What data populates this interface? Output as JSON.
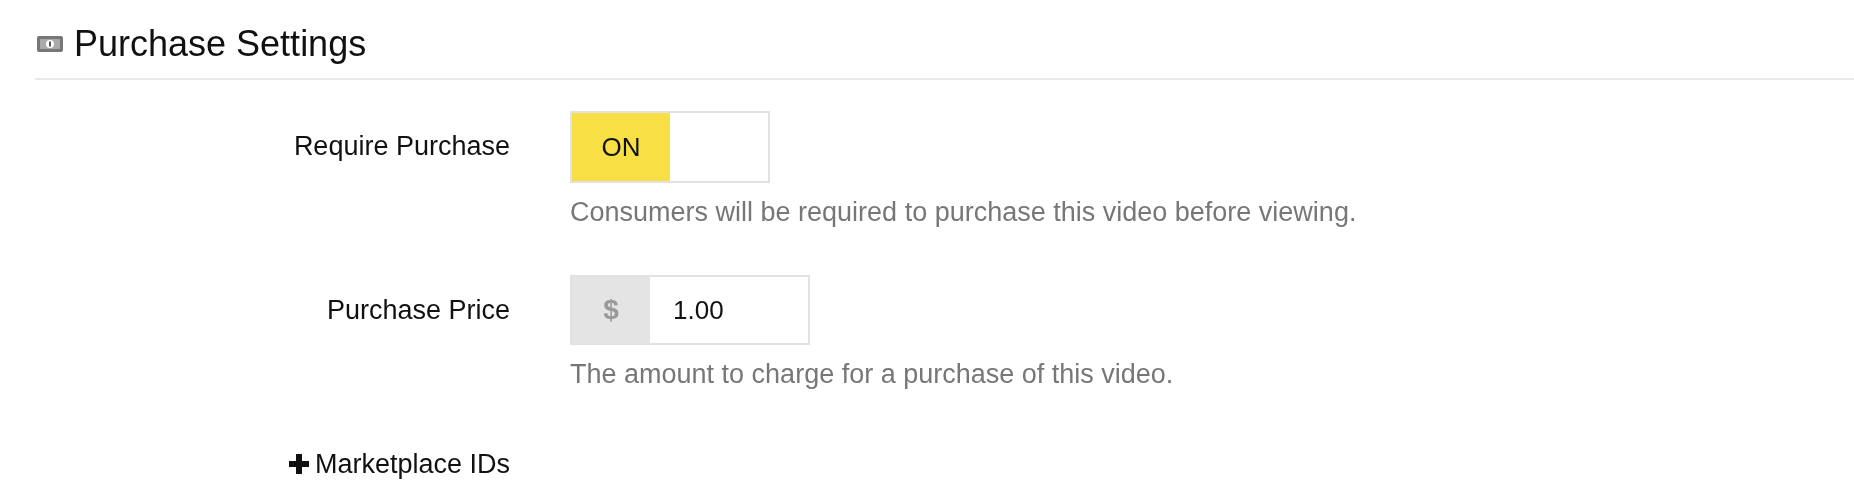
{
  "section": {
    "title": "Purchase Settings"
  },
  "fields": [
    {
      "kind": "toggle",
      "label": "Require Purchase",
      "on": true,
      "on_text": "ON",
      "help": "Consumers will be required to purchase this video before viewing."
    },
    {
      "kind": "price",
      "label": "Purchase Price",
      "prefix": "$",
      "value": "1.00",
      "help": "The amount to charge for a purchase of this video."
    }
  ],
  "expander": {
    "label": "Marketplace IDs",
    "expanded": false
  }
}
